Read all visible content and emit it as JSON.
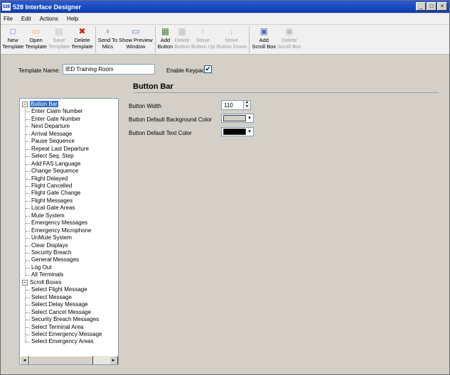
{
  "window": {
    "title": "528 Interface Designer",
    "app_icon_text": "528",
    "controls": [
      "_",
      "□",
      "×"
    ]
  },
  "menu": [
    "File",
    "Edit",
    "Actions",
    "Help"
  ],
  "toolbar": [
    {
      "label1": "New",
      "label2": "Template",
      "icon": "new-template-icon",
      "glyph": "□",
      "enabled": true
    },
    {
      "label1": "Open",
      "label2": "Template",
      "icon": "open-folder-icon",
      "glyph": "▭",
      "enabled": true
    },
    {
      "label1": "Save",
      "label2": "Template",
      "icon": "save-icon",
      "glyph": "▤",
      "enabled": false
    },
    {
      "label1": "Delete",
      "label2": "Template",
      "icon": "delete-icon",
      "glyph": "✖",
      "enabled": true
    },
    {
      "label1": "Send To",
      "label2": "Mics",
      "icon": "microphone-icon",
      "glyph": "♀",
      "enabled": true
    },
    {
      "label1": "Show Preview",
      "label2": "Window",
      "icon": "preview-window-icon",
      "glyph": "▭",
      "enabled": true
    },
    {
      "label1": "Add",
      "label2": "Button",
      "icon": "add-button-icon",
      "glyph": "▦",
      "enabled": true
    },
    {
      "label1": "Delete",
      "label2": "Button",
      "icon": "delete-button-icon",
      "glyph": "▦",
      "enabled": false
    },
    {
      "label1": "Move",
      "label2": "Button Up",
      "icon": "arrow-up-icon",
      "glyph": "↑",
      "enabled": false
    },
    {
      "label1": "Move",
      "label2": "Button Down",
      "icon": "arrow-down-icon",
      "glyph": "↓",
      "enabled": false
    },
    {
      "label1": "Add",
      "label2": "Scroll Box",
      "icon": "add-scrollbox-icon",
      "glyph": "▣",
      "enabled": true
    },
    {
      "label1": "Delete",
      "label2": "Scroll Box",
      "icon": "delete-scrollbox-icon",
      "glyph": "▣",
      "enabled": false
    }
  ],
  "form": {
    "template_name_label": "Template Name:",
    "template_name_value": "IED Training Room",
    "enable_keypad_label": "Enable Keypad:",
    "enable_keypad_checked": "✔"
  },
  "tree": {
    "groups": [
      {
        "label": "Button Bar",
        "expander": "−",
        "selected": true,
        "children": [
          "Enter Claim Number",
          "Enter Gate Number",
          "Next Departure",
          "Arrival Message",
          "Pause Sequence",
          "Repeat Last Departure",
          "Select Seq. Step",
          "Add FAS Language",
          "Change Sequence",
          "Flight Delayed",
          "Flight Cancelled",
          "Flight Gate Change",
          "Flight Messages",
          "Local Gate Areas",
          "Mute System",
          "Emergency Messages",
          "Emergency Microphone",
          "UnMute System",
          "Clear Displays",
          "Security Breach",
          "General Messages",
          "Log Out",
          "All Terminals"
        ]
      },
      {
        "label": "Scroll Boxes",
        "expander": "−",
        "selected": false,
        "children": [
          "Select Flight Message",
          "Select Message",
          "Select Delay Message",
          "Select Cancel Message",
          "Security Breach Messages",
          "Select Terminal Area",
          "Select Emergency Message",
          "Select Emergency Areas"
        ]
      }
    ],
    "scroll_left": "◂",
    "scroll_right": "▸"
  },
  "panel": {
    "title": "Button Bar",
    "button_width_label": "Button Width",
    "button_width_value": "110",
    "bg_color_label": "Button Default Background Color",
    "bg_color": "#d4d0c8",
    "text_color_label": "Button Default Text Color",
    "text_color": "#000000",
    "spin_up": "▲",
    "spin_down": "▼",
    "dropdown_arrow": "▾"
  }
}
